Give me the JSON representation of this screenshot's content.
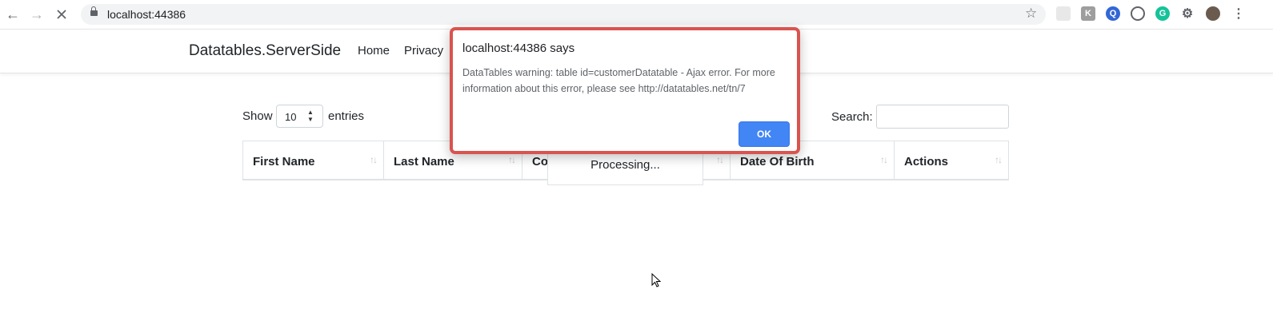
{
  "browser": {
    "url": "localhost:44386",
    "extension_letters": [
      "",
      "K",
      "Q",
      "",
      "G",
      "",
      ""
    ]
  },
  "navbar": {
    "brand": "Datatables.ServerSide",
    "links": [
      "Home",
      "Privacy"
    ]
  },
  "datatable": {
    "length_prefix": "Show",
    "length_value": "10",
    "length_suffix": "entries",
    "search_label": "Search:",
    "search_value": "",
    "columns": [
      "First Name",
      "Last Name",
      "Co",
      "",
      "Date Of Birth",
      "Actions"
    ],
    "processing_text": "Processing..."
  },
  "dialog": {
    "title": "localhost:44386 says",
    "message": "DataTables warning: table id=customerDatatable - Ajax error. For more information about this error, please see http://datatables.net/tn/7",
    "ok_label": "OK",
    "border_color": "#d9534f",
    "button_color": "#4285f4"
  }
}
